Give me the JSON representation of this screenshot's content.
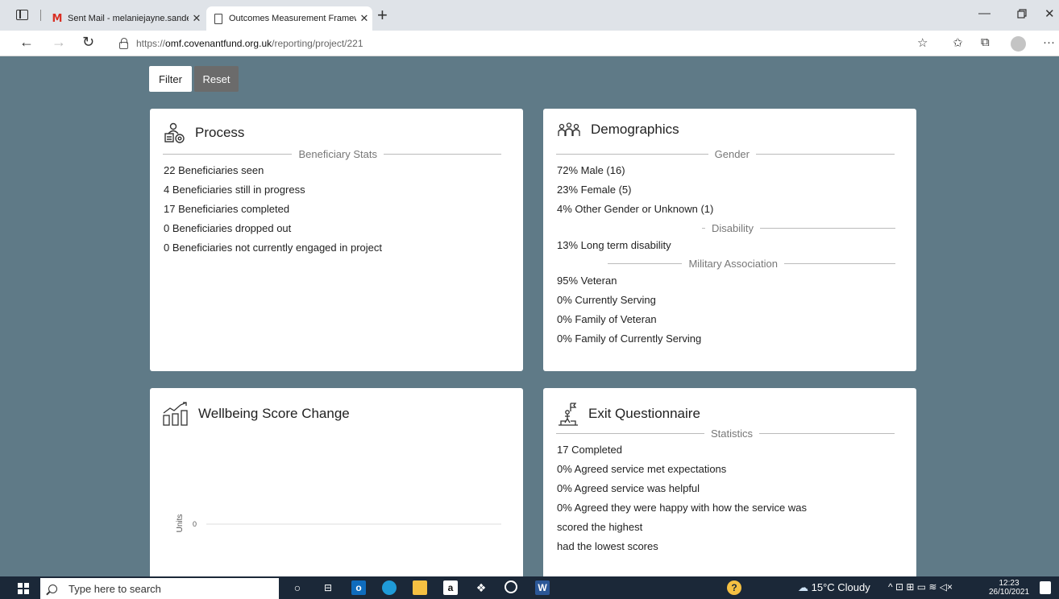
{
  "browser": {
    "tabs": [
      {
        "title": "Sent Mail - melaniejayne.sanders",
        "active": false
      },
      {
        "title": "Outcomes Measurement Framew",
        "active": true
      }
    ],
    "address": {
      "protocol": "https://",
      "host": "omf.covenantfund.org.uk",
      "path": "/reporting/project/221"
    }
  },
  "filters": {
    "filter_label": "Filter",
    "reset_label": "Reset"
  },
  "process": {
    "title": "Process",
    "section": "Beneficiary Stats",
    "rows": [
      "22 Beneficiaries seen",
      "4 Beneficiaries still in progress",
      "17 Beneficiaries completed",
      "0 Beneficiaries dropped out",
      "0 Beneficiaries not currently engaged in project"
    ]
  },
  "demographics": {
    "title": "Demographics",
    "gender_label": "Gender",
    "gender": [
      "72% Male (16)",
      "23% Female (5)",
      "4% Other Gender or Unknown (1)"
    ],
    "disability_label": "Disability",
    "disability": [
      "13% Long term disability"
    ],
    "military_label": "Military Association",
    "military": [
      "95% Veteran",
      "0% Currently Serving",
      "0% Family of Veteran",
      "0% Family of Currently Serving"
    ]
  },
  "wellbeing": {
    "title": "Wellbeing Score Change",
    "chart_data": {
      "type": "line",
      "title": "",
      "ylabel": "Units",
      "xlabel": "",
      "y_ticks": [
        "0"
      ],
      "series": []
    }
  },
  "exit": {
    "title": "Exit Questionnaire",
    "section": "Statistics",
    "rows": [
      "17 Completed",
      "0% Agreed service met expectations",
      "0% Agreed service was helpful",
      "0% Agreed they were happy with how the service was",
      "scored the highest",
      "had the lowest scores"
    ]
  },
  "taskbar": {
    "search_placeholder": "Type here to search",
    "weather": "15°C  Cloudy",
    "time": "12:23",
    "date": "26/10/2021"
  }
}
